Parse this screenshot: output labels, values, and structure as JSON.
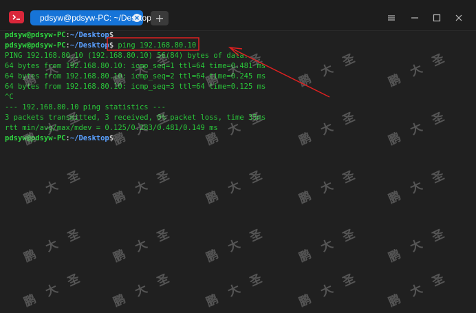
{
  "window": {
    "tab_title": "pdsyw@pdsyw-PC: ~/Desktop",
    "new_tab_symbol": "+",
    "icons": {
      "app": "terminal-icon",
      "tab_close": "close-icon",
      "menu": "hamburger-menu-icon",
      "minimize": "minimize-icon",
      "maximize": "maximize-icon",
      "close": "close-icon"
    }
  },
  "terminal": {
    "prompt": {
      "user": "pdsyw@pdsyw-PC",
      "separator": ":",
      "path": "~/Desktop",
      "symbol": "$"
    },
    "command": " ping 192.168.80.10",
    "output": [
      "PING 192.168.80.10 (192.168.80.10) 56(84) bytes of data.",
      "64 bytes from 192.168.80.10: icmp_seq=1 ttl=64 time=0.481 ms",
      "64 bytes from 192.168.80.10: icmp_seq=2 ttl=64 time=0.245 ms",
      "64 bytes from 192.168.80.10: icmp_seq=3 ttl=64 time=0.125 ms",
      "^C",
      "--- 192.168.80.10 ping statistics ---",
      "3 packets transmitted, 3 received, 0% packet loss, time 35ms",
      "rtt min/avg/max/mdev = 0.125/0.283/0.481/0.149 ms"
    ]
  },
  "watermark": {
    "text": "鹏大圣"
  },
  "colors": {
    "terminal_bg": "#202020",
    "text_green": "#29c73a",
    "path_blue": "#5aa0ff",
    "tab_blue": "#1674d8",
    "annotation_red": "#e02020"
  }
}
